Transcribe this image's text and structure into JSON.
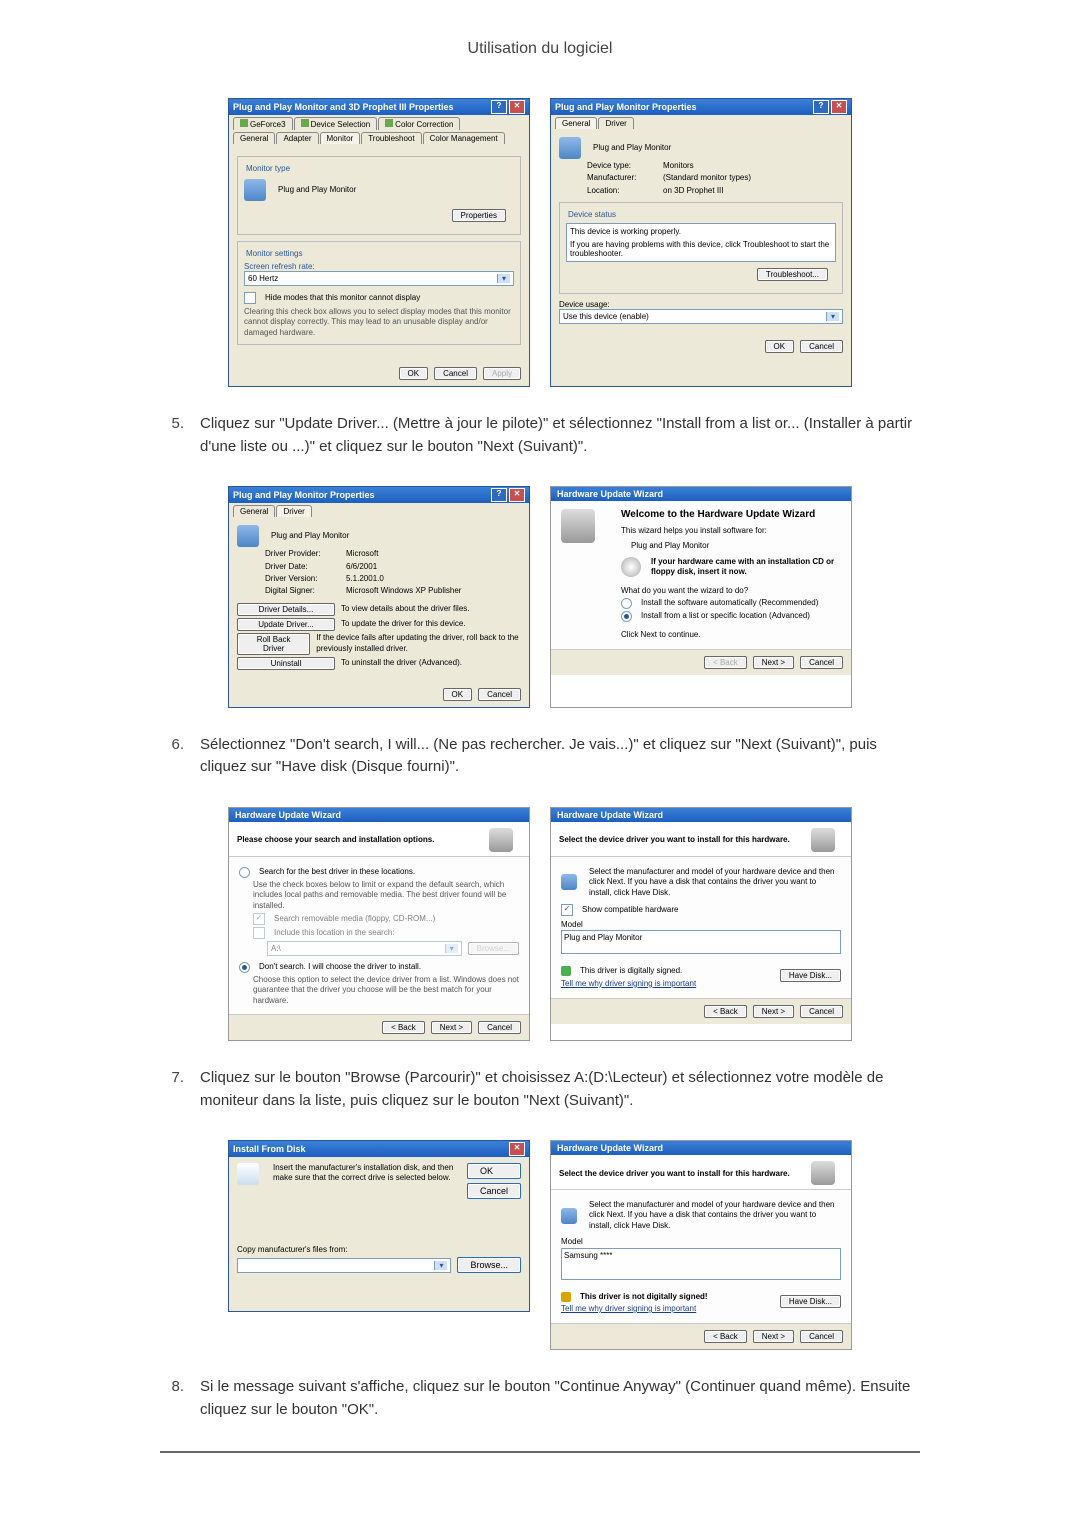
{
  "page_title": "Utilisation du logiciel",
  "common": {
    "ok": "OK",
    "cancel": "Cancel",
    "apply": "Apply",
    "back": "< Back",
    "next": "Next >",
    "browse": "Browse...",
    "close_sym": "✕",
    "help_sym": "?"
  },
  "dlg1a": {
    "title": "Plug and Play Monitor and 3D Prophet III Properties",
    "tabs_top": [
      "GeForce3",
      "Device Selection",
      "Color Correction"
    ],
    "tabs_bot": [
      "General",
      "Adapter",
      "Monitor",
      "Troubleshoot",
      "Color Management"
    ],
    "monitor_type": "Monitor type",
    "monitor_name": "Plug and Play Monitor",
    "properties": "Properties",
    "monitor_settings": "Monitor settings",
    "refresh_label": "Screen refresh rate:",
    "refresh_value": "60 Hertz",
    "hide_modes": "Hide modes that this monitor cannot display",
    "hide_help": "Clearing this check box allows you to select display modes that this monitor cannot display correctly. This may lead to an unusable display and/or damaged hardware."
  },
  "dlg1b": {
    "title": "Plug and Play Monitor Properties",
    "tabs": [
      "General",
      "Driver"
    ],
    "header": "Plug and Play Monitor",
    "device_type_l": "Device type:",
    "device_type_v": "Monitors",
    "manuf_l": "Manufacturer:",
    "manuf_v": "(Standard monitor types)",
    "loc_l": "Location:",
    "loc_v": "on 3D Prophet III",
    "status_legend": "Device status",
    "status_text": "This device is working properly.",
    "status_help": "If you are having problems with this device, click Troubleshoot to start the troubleshooter.",
    "troubleshoot": "Troubleshoot...",
    "usage_l": "Device usage:",
    "usage_v": "Use this device (enable)"
  },
  "step5": "Cliquez sur \"Update Driver... (Mettre à jour le pilote)\" et sélectionnez \"Install from a list or... (Installer à partir d'une liste ou ...)\" et cliquez sur le bouton \"Next (Suivant)\".",
  "dlg2a": {
    "title": "Plug and Play Monitor Properties",
    "tabs": [
      "General",
      "Driver"
    ],
    "header": "Plug and Play Monitor",
    "provider_l": "Driver Provider:",
    "provider_v": "Microsoft",
    "date_l": "Driver Date:",
    "date_v": "6/6/2001",
    "ver_l": "Driver Version:",
    "ver_v": "5.1.2001.0",
    "signer_l": "Digital Signer:",
    "signer_v": "Microsoft Windows XP Publisher",
    "btn_details": "Driver Details...",
    "btn_details_t": "To view details about the driver files.",
    "btn_update": "Update Driver...",
    "btn_update_t": "To update the driver for this device.",
    "btn_roll": "Roll Back Driver",
    "btn_roll_t": "If the device fails after updating the driver, roll back to the previously installed driver.",
    "btn_uninst": "Uninstall",
    "btn_uninst_t": "To uninstall the driver (Advanced)."
  },
  "dlg2b": {
    "title": "Hardware Update Wizard",
    "welcome": "Welcome to the Hardware Update Wizard",
    "help1": "This wizard helps you install software for:",
    "device": "Plug and Play Monitor",
    "insert": "If your hardware came with an installation CD or floppy disk, insert it now.",
    "what": "What do you want the wizard to do?",
    "opt1": "Install the software automatically (Recommended)",
    "opt2": "Install from a list or specific location (Advanced)",
    "cont": "Click Next to continue."
  },
  "step6": "Sélectionnez \"Don't search, I will... (Ne pas rechercher. Je vais...)\" et cliquez sur \"Next (Suivant)\", puis cliquez sur \"Have disk (Disque fourni)\".",
  "dlg3a": {
    "title": "Hardware Update Wizard",
    "sub": "Please choose your search and installation options.",
    "opt1": "Search for the best driver in these locations.",
    "opt1_help": "Use the check boxes below to limit or expand the default search, which includes local paths and removable media. The best driver found will be installed.",
    "chk1": "Search removable media (floppy, CD-ROM...)",
    "chk2": "Include this location in the search:",
    "path": "A:\\",
    "opt2": "Don't search. I will choose the driver to install.",
    "opt2_help": "Choose this option to select the device driver from a list. Windows does not guarantee that the driver you choose will be the best match for your hardware."
  },
  "dlg3b": {
    "title": "Hardware Update Wizard",
    "sub": "Select the device driver you want to install for this hardware.",
    "help": "Select the manufacturer and model of your hardware device and then click Next. If you have a disk that contains the driver you want to install, click Have Disk.",
    "show_compat": "Show compatible hardware",
    "model": "Model",
    "model_item": "Plug and Play Monitor",
    "signed": "This driver is digitally signed.",
    "why": "Tell me why driver signing is important",
    "have_disk": "Have Disk..."
  },
  "step7": "Cliquez sur le bouton \"Browse (Parcourir)\" et choisissez A:(D:\\Lecteur) et sélectionnez votre modèle de moniteur dans la liste, puis cliquez sur le bouton \"Next (Suivant)\".",
  "dlg4a": {
    "title": "Install From Disk",
    "msg": "Insert the manufacturer's installation disk, and then make sure that the correct drive is selected below.",
    "copy": "Copy manufacturer's files from:",
    "path": ""
  },
  "dlg4b": {
    "title": "Hardware Update Wizard",
    "sub": "Select the device driver you want to install for this hardware.",
    "help": "Select the manufacturer and model of your hardware device and then click Next. If you have a disk that contains the driver you want to install, click Have Disk.",
    "model": "Model",
    "model_item": "Samsung ****",
    "signed": "This driver is not digitally signed!",
    "why": "Tell me why driver signing is important",
    "have_disk": "Have Disk..."
  },
  "step8": "Si le message suivant s'affiche, cliquez sur le bouton \"Continue Anyway\" (Continuer quand même). Ensuite cliquez sur le bouton \"OK\"."
}
